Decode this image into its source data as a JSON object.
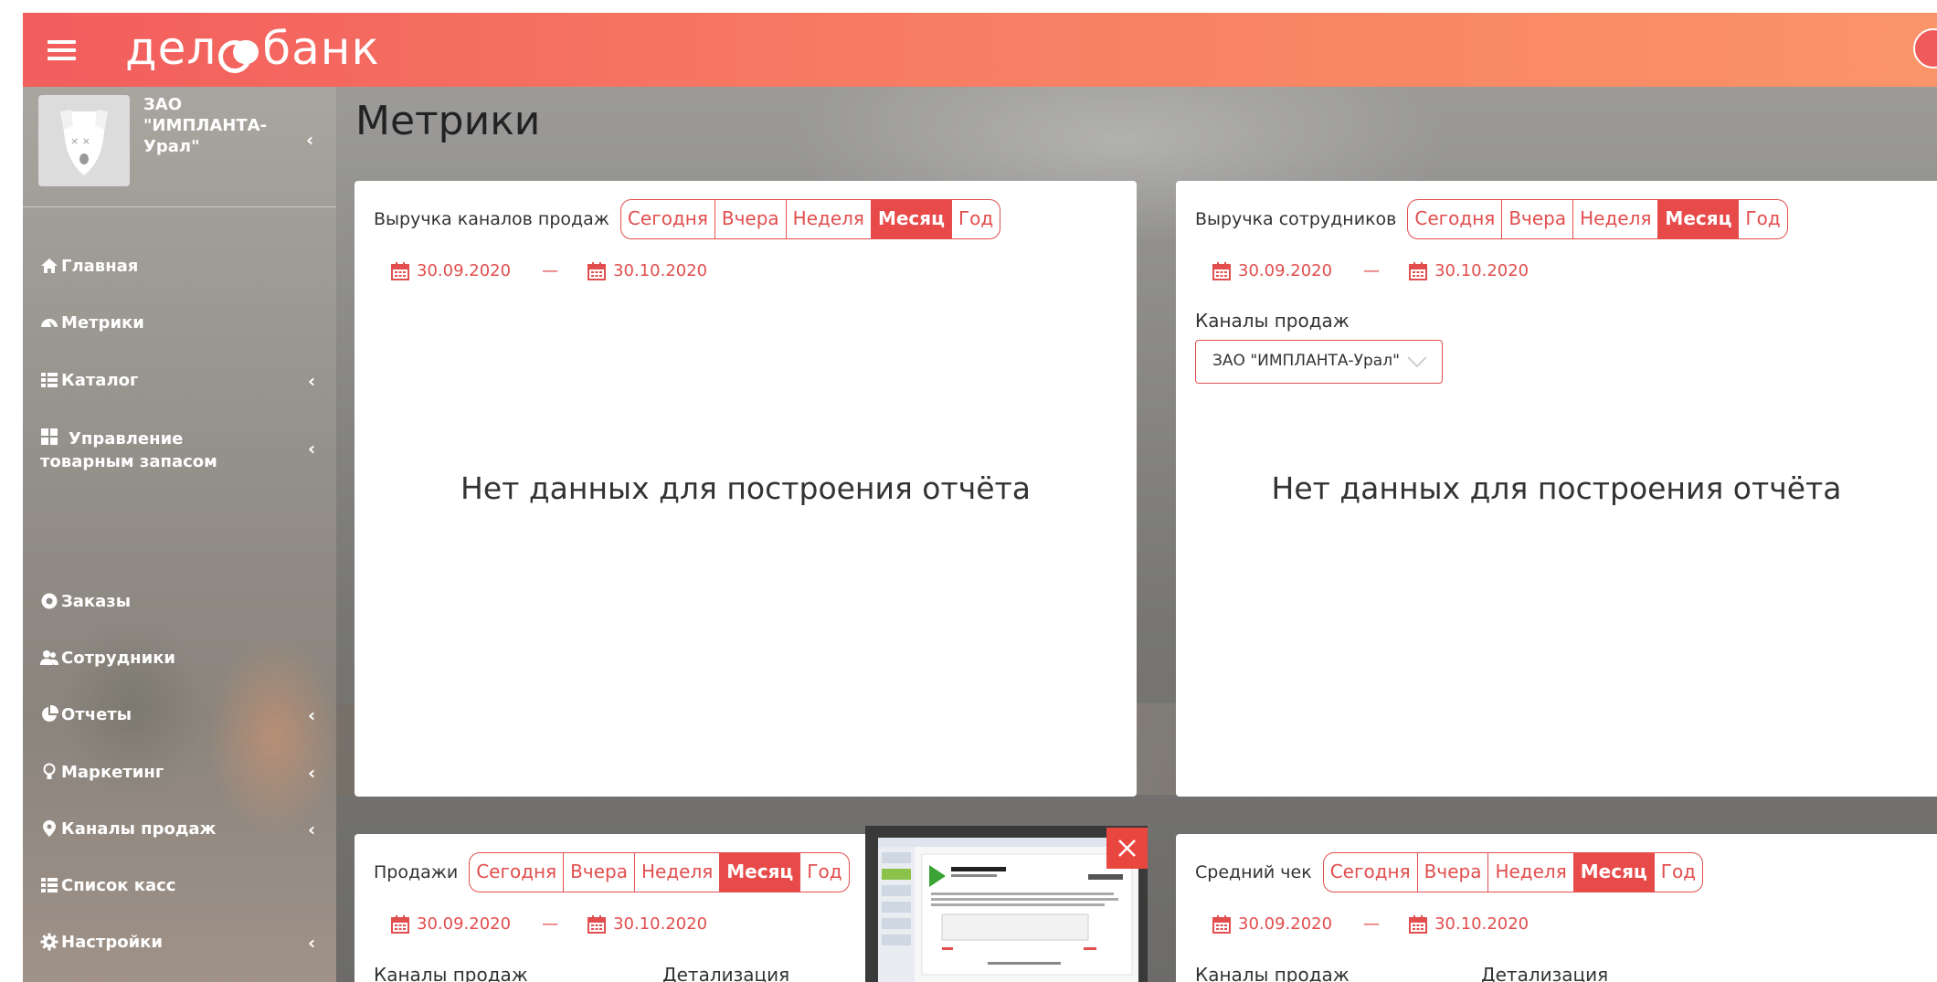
{
  "brand": {
    "logo_prefix": "дел",
    "logo_suffix": "банк",
    "accent": "#e24e4e"
  },
  "profile": {
    "company": "ЗАО \"ИМПЛАНТА-Урал\""
  },
  "sidebar": {
    "items": [
      {
        "label": "Главная",
        "icon": "home-icon",
        "has_children": false
      },
      {
        "label": "Метрики",
        "icon": "dashboard-icon",
        "has_children": false
      },
      {
        "label": "Каталог",
        "icon": "list-icon",
        "has_children": true
      },
      {
        "label": "Управление товарным запасом",
        "icon": "grid-icon",
        "has_children": true
      },
      {
        "label": "Заказы",
        "icon": "support-icon",
        "has_children": false
      },
      {
        "label": "Сотрудники",
        "icon": "users-icon",
        "has_children": false
      },
      {
        "label": "Отчеты",
        "icon": "pie-chart-icon",
        "has_children": true
      },
      {
        "label": "Маркетинг",
        "icon": "lightbulb-icon",
        "has_children": true
      },
      {
        "label": "Каналы продаж",
        "icon": "map-marker-icon",
        "has_children": true
      },
      {
        "label": "Список касс",
        "icon": "list-icon",
        "has_children": false
      },
      {
        "label": "Настройки",
        "icon": "gear-icon",
        "has_children": true
      }
    ]
  },
  "page": {
    "title": "Метрики"
  },
  "periods": [
    "Сегодня",
    "Вчера",
    "Неделя",
    "Месяц",
    "Год"
  ],
  "active_period": "Месяц",
  "no_data": "Нет данных для построения отчёта",
  "dash": "—",
  "cards": {
    "channels_revenue": {
      "title": "Выручка каналов продаж",
      "date_from": "30.09.2020",
      "date_to": "30.10.2020"
    },
    "staff_revenue": {
      "title": "Выручка сотрудников",
      "date_from": "30.09.2020",
      "date_to": "30.10.2020",
      "channels_label": "Каналы продаж",
      "channels_value": "ЗАО \"ИМПЛАНТА-Урал\""
    },
    "sales": {
      "title": "Продажи",
      "date_from": "30.09.2020",
      "date_to": "30.10.2020",
      "channels_label": "Каналы продаж",
      "detail_label": "Детализация"
    },
    "avg_check": {
      "title": "Средний чек",
      "date_from": "30.09.2020",
      "date_to": "30.10.2020",
      "channels_label": "Каналы продаж",
      "detail_label": "Детализация"
    }
  }
}
